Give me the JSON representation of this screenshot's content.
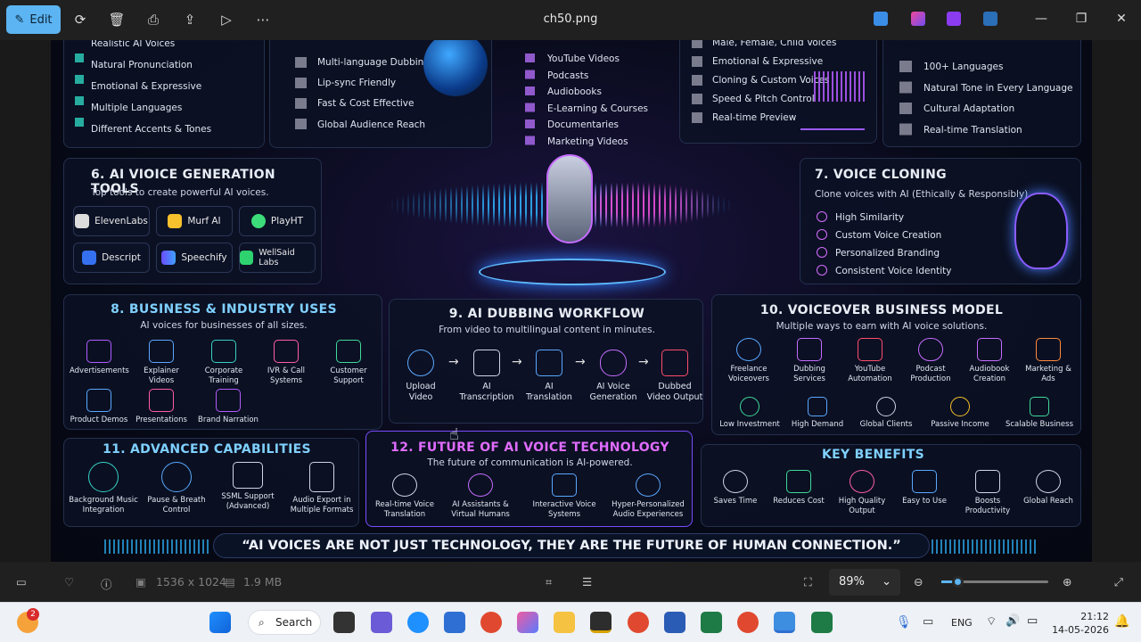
{
  "window": {
    "edit_label": "Edit",
    "file_name": "ch50.png"
  },
  "status": {
    "dimensions": "1536 x 1024",
    "size": "1.9 MB",
    "zoom": "89%"
  },
  "taskbar": {
    "search": "Search",
    "lang": "ENG",
    "time": "21:12",
    "date": "14-05-2026",
    "badge": "2"
  },
  "image": {
    "top1": [
      "Realistic AI Voices",
      "Natural Pronunciation",
      "Emotional & Expressive",
      "Multiple Languages",
      "Different Accents & Tones"
    ],
    "top2": [
      "Multi-language Dubbing",
      "Lip-sync Friendly",
      "Fast & Cost Effective",
      "Global Audience Reach"
    ],
    "top3": [
      "YouTube Videos",
      "Podcasts",
      "Audiobooks",
      "E-Learning & Courses",
      "Documentaries",
      "Marketing Videos"
    ],
    "top4": [
      "Male, Female, Child Voices",
      "Emotional & Expressive",
      "Cloning & Custom Voices",
      "Speed & Pitch Control",
      "Real-time Preview"
    ],
    "top5": [
      "100+ Languages",
      "Natural Tone in Every Language",
      "Cultural Adaptation",
      "Real-time Translation"
    ],
    "tools": {
      "title": "6. AI VIOICE GENERATION TOOLS",
      "sub": "Top tools to create powerful AI voices.",
      "items": [
        "ElevenLabs",
        "Murf AI",
        "PlayHT",
        "Descript",
        "Speechify",
        "WellSaid Labs"
      ]
    },
    "cloning": {
      "title": "7. VOICE CLONING",
      "sub": "Clone voices with AI (Ethically & Responsibly).",
      "items": [
        "High Similarity",
        "Custom Voice Creation",
        "Personalized Branding",
        "Consistent Voice Identity"
      ]
    },
    "business": {
      "title": "8. BUSINESS & INDUSTRY USES",
      "sub": "AI voices for businesses of all sizes.",
      "items": [
        "Advertisements",
        "Explainer Videos",
        "Corporate Training",
        "IVR & Call Systems",
        "Customer Support",
        "Product Demos",
        "Presentations",
        "Brand Narration"
      ]
    },
    "dubbing": {
      "title": "9. AI DUBBING WORKFLOW",
      "sub": "From video to multilingual content in minutes.",
      "steps": [
        "Upload Video",
        "AI Transcription",
        "AI Translation",
        "AI Voice Generation",
        "Dubbed Video Output"
      ]
    },
    "model": {
      "title": "10. VOICEOVER BUSINESS MODEL",
      "sub": "Multiple ways to earn with AI voice solutions.",
      "items": [
        "Freelance Voiceovers",
        "Dubbing Services",
        "YouTube Automation",
        "Podcast Production",
        "Audiobook Creation",
        "Marketing & Ads"
      ],
      "items2": [
        "Low Investment",
        "High Demand",
        "Global Clients",
        "Passive Income",
        "Scalable Business"
      ]
    },
    "advanced": {
      "title": "11. ADVANCED CAPABILITIES",
      "items": [
        "Background Music Integration",
        "Pause & Breath Control",
        "SSML Support (Advanced)",
        "Audio Export in Multiple Formats"
      ]
    },
    "future": {
      "title": "12. FUTURE OF AI VOICE TECHNOLOGY",
      "sub": "The future of communication is AI-powered.",
      "items": [
        "Real-time Voice Translation",
        "AI Assistants & Virtual Humans",
        "Interactive Voice Systems",
        "Hyper-Personalized Audio Experiences"
      ]
    },
    "benefits": {
      "title": "KEY BENEFITS",
      "items": [
        "Saves Time",
        "Reduces Cost",
        "High Quality Output",
        "Easy to Use",
        "Boosts Productivity",
        "Global Reach"
      ]
    },
    "quote": "“AI VOICES ARE NOT JUST TECHNOLOGY, THEY ARE THE FUTURE OF HUMAN CONNECTION.”"
  }
}
